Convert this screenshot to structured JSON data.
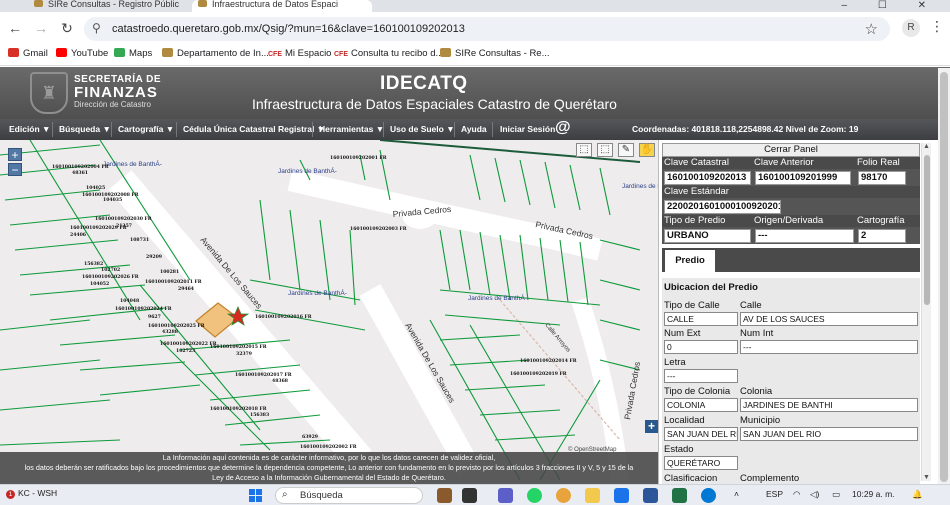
{
  "browser": {
    "tabs": [
      {
        "label": "SIRe Consultas - Registro Públic"
      },
      {
        "label": "Infraestructura de Datos Espaci"
      }
    ],
    "url": "catastroedo.queretaro.gob.mx/Qsig/?mun=16&clave=160100109202013",
    "profile": "R",
    "bookmarks": [
      {
        "label": "Gmail",
        "color": "#d93025"
      },
      {
        "label": "YouTube",
        "color": "#ff0000"
      },
      {
        "label": "Maps",
        "color": "#34a853"
      },
      {
        "label": "Departamento de In...",
        "color": "#b08a3e"
      },
      {
        "label": "Mi Espacio",
        "color": "#c62828",
        "prefix": "CFE"
      },
      {
        "label": "Consulta tu recibo d...",
        "color": "#c62828",
        "prefix": "CFE"
      },
      {
        "label": "SIRe Consultas - Re...",
        "color": "#b08a3e"
      }
    ]
  },
  "header": {
    "org_line1": "SECRETARÍA DE",
    "org_line2": "FINANZAS",
    "org_line3": "Dirección de Catastro",
    "title": "IDECATQ",
    "subtitle": "Infraestructura de Datos Espaciales Catastro de Querétaro"
  },
  "menu": {
    "items": [
      "Edición ▼",
      "Búsqueda ▼",
      "Cartografía ▼",
      "Cédula Única Catastral Registral ▼",
      "Herramientas ▼",
      "Uso de Suelo ▼",
      "Ayuda",
      "Iniciar Sesión"
    ],
    "coords": "Coordenadas: 401818.118,2254898.42 Nivel de Zoom: 19"
  },
  "map": {
    "roads": [
      "Avenida De Los Sauces",
      "Privada Cedros",
      "Privada Cedros",
      "Avenida De Los Sauces",
      "Privada Cedros",
      "Calle Arroyos"
    ],
    "jardines": [
      "Jardines de BanthÁ-",
      "Jardines de BanthÁ-",
      "Jardines de BanthÁ-",
      "Jardines de BanthÁ-",
      "Jardines de BanthÁ-"
    ],
    "parcels": [
      "160100109202004 FR",
      "160100109202008 FR",
      "160100109202029 FR",
      "160100109202030 FR",
      "160100109202026 FR",
      "160100109202011 FR",
      "160100109202024 FR",
      "160100109202025 FR",
      "160100109202022 FR",
      "160100109202015 FR",
      "160100109202017 FR",
      "160100109202018 FR",
      "160100109202019 FR",
      "160100109202003 FR",
      "160100109202016 FR",
      "160100109202014 FR",
      "160100109202001 FR",
      "160100109202002 FR"
    ],
    "parcel_numbers": [
      "48361",
      "104025",
      "104035",
      "21357",
      "24406",
      "102702",
      "156382",
      "104052",
      "104048",
      "9627",
      "43288",
      "102723",
      "32379",
      "48368",
      "156383",
      "63929",
      "100281",
      "29209",
      "29464",
      "108731"
    ],
    "attribution": "© OpenStreetMap"
  },
  "disclaimer": {
    "line1": "La Información aquí contenida es de carácter informativo, por lo que los datos carecen de validez oficial,",
    "line2": "los datos deberán ser ratificados bajo los procedimientos que determine la dependencia competente, Lo anterior con fundamento en lo previsto por los artículos 3 fracciones II y V, 5 y 15 de la",
    "line3": "Ley de Acceso a la Información Gubernamental del Estado de Querétaro."
  },
  "panel": {
    "close_label": "Cerrar Panel",
    "clave_catastral_label": "Clave Catastral",
    "clave_anterior_label": "Clave Anterior",
    "folio_real_label": "Folio Real",
    "clave_catastral": "160100109202013",
    "clave_anterior": "160100109201999",
    "folio_real": "98170",
    "clave_estandar_label": "Clave Estándar",
    "clave_estandar": "22002016010001009202013",
    "tipo_predio_label": "Tipo de Predio",
    "origen_label": "Origen/Derivada",
    "cartografia_label": "Cartografía",
    "tipo_predio": "URBANO",
    "origen": "---",
    "cartografia": "2",
    "tab_predio": "Predio",
    "ubicacion_title": "Ubicacion del Predio",
    "tipo_calle_label": "Tipo de Calle",
    "calle_label": "Calle",
    "tipo_calle": "CALLE",
    "calle": "AV DE LOS SAUCES",
    "num_ext_label": "Num Ext",
    "num_int_label": "Num Int",
    "num_ext": "0",
    "num_int": "---",
    "letra_label": "Letra",
    "letra": "---",
    "tipo_colonia_label": "Tipo de Colonia",
    "colonia_label": "Colonia",
    "tipo_colonia": "COLONIA",
    "colonia": "JARDINES DE BANTHI",
    "localidad_label": "Localidad",
    "municipio_label": "Municipio",
    "localidad": "SAN JUAN DEL RIO",
    "municipio": "SAN JUAN DEL RIO",
    "estado_label": "Estado",
    "estado": "QUERÉTARO",
    "clasificacion_label": "Clasificacion",
    "complemento_label": "Complemento"
  },
  "taskbar": {
    "app_label": "KC - WSH",
    "badge": "1",
    "search_placeholder": "Búsqueda",
    "lang": "ESP",
    "time": "10:29 a. m."
  }
}
